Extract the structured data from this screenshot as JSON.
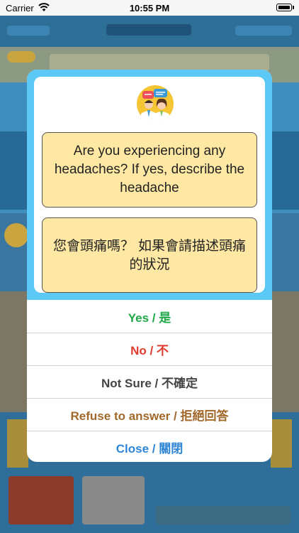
{
  "status_bar": {
    "carrier": "Carrier",
    "time": "10:55 PM"
  },
  "modal": {
    "question_en": "Are you experiencing any headaches? If yes, describe the headache",
    "question_zh": "您會頭痛嗎？ 如果會請描述頭痛的狀況",
    "options": [
      {
        "label": "Yes / 是",
        "color": "#21a849"
      },
      {
        "label": "No / 不",
        "color": "#e03b2e"
      },
      {
        "label": "Not Sure / 不確定",
        "color": "#444444"
      },
      {
        "label": "Refuse to answer / 拒絕回答",
        "color": "#a0682a"
      },
      {
        "label": "Close / 關閉",
        "color": "#2f86d6"
      }
    ]
  },
  "colors": {
    "modal_header": "#5bc8f5",
    "question_box": "#ffe8a3"
  }
}
